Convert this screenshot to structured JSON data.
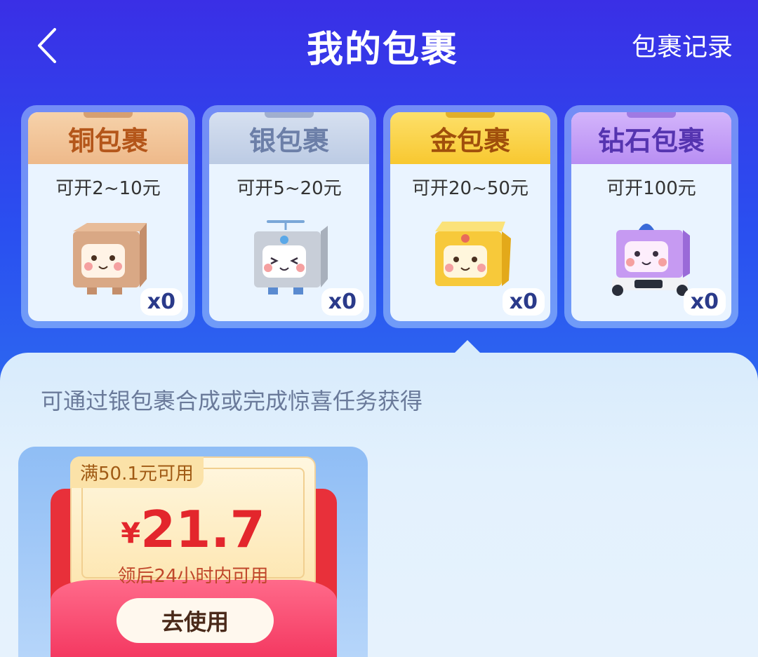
{
  "header": {
    "title": "我的包裹",
    "records_label": "包裹记录"
  },
  "packages": [
    {
      "name": "铜包裹",
      "range": "可开2~10元",
      "count": "x0",
      "head_color": "#f2c9a0",
      "text_color": "#b05a1a"
    },
    {
      "name": "银包裹",
      "range": "可开5~20元",
      "count": "x0",
      "head_color": "#c9d6ea",
      "text_color": "#6b7ea6"
    },
    {
      "name": "金包裹",
      "range": "可开20~50元",
      "count": "x0",
      "head_color": "#fbd44a",
      "text_color": "#a0520e"
    },
    {
      "name": "钻石包裹",
      "range": "可开100元",
      "count": "x0",
      "head_color": "#c9a8f8",
      "text_color": "#5a3ab6"
    }
  ],
  "hint": "可通过银包裹合成或完成惊喜任务获得",
  "coupon": {
    "threshold": "满50.1元可用",
    "currency": "¥",
    "amount": "21.7",
    "validity": "领后24小时内可用",
    "use_label": "去使用"
  }
}
